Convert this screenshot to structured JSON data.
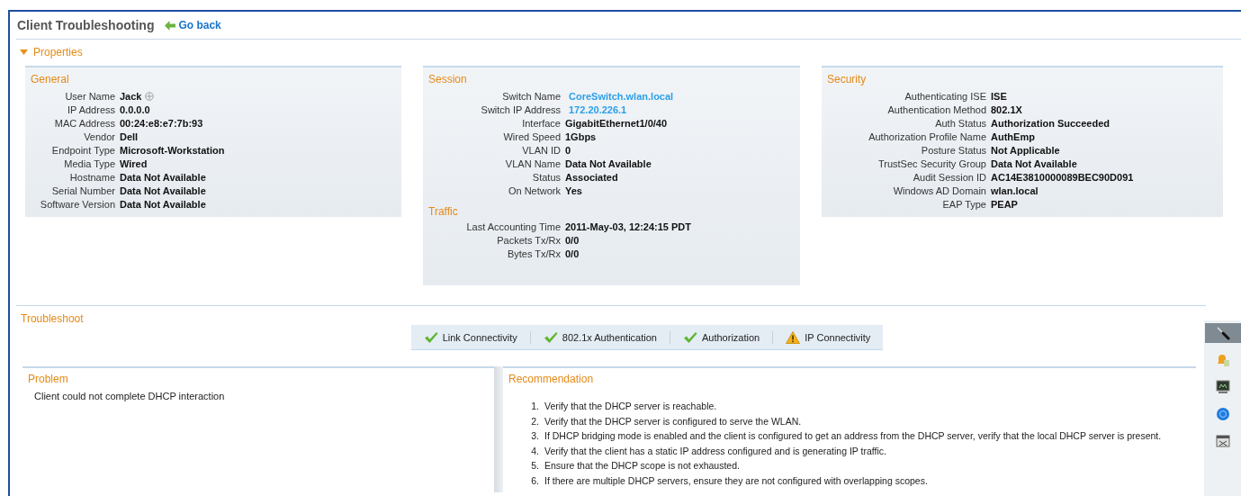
{
  "header": {
    "title": "Client Troubleshooting",
    "back_link": "Go back"
  },
  "properties": {
    "label": "Properties",
    "expanded": true,
    "panels": [
      {
        "title": "General",
        "sections": [
          {
            "fields": [
              {
                "label": "User Name",
                "value": "Jack",
                "kind": "text-with-icon"
              },
              {
                "label": "IP Address",
                "value": "0.0.0.0",
                "kind": "text"
              },
              {
                "label": "MAC Address",
                "value": "00:24:e8:e7:7b:93",
                "kind": "text"
              },
              {
                "label": "Vendor",
                "value": "Dell",
                "kind": "text"
              },
              {
                "label": "Endpoint Type",
                "value": "Microsoft-Workstation",
                "kind": "text"
              },
              {
                "label": "Media Type",
                "value": "Wired",
                "kind": "text"
              },
              {
                "label": "Hostname",
                "value": "Data Not Available",
                "kind": "text"
              },
              {
                "label": "Serial Number",
                "value": "Data Not Available",
                "kind": "text"
              },
              {
                "label": "Software Version",
                "value": "Data Not Available",
                "kind": "text"
              }
            ]
          }
        ]
      },
      {
        "title": "Session",
        "sections": [
          {
            "fields": [
              {
                "label": "Switch Name",
                "value": "CoreSwitch.wlan.local",
                "kind": "link"
              },
              {
                "label": "Switch IP Address",
                "value": "172.20.226.1",
                "kind": "link"
              },
              {
                "label": "Interface",
                "value": "GigabitEthernet1/0/40",
                "kind": "text"
              },
              {
                "label": "Wired Speed",
                "value": "1Gbps",
                "kind": "text"
              },
              {
                "label": "VLAN ID",
                "value": "0",
                "kind": "text"
              },
              {
                "label": "VLAN Name",
                "value": "Data Not Available",
                "kind": "text"
              },
              {
                "label": "Status",
                "value": "Associated",
                "kind": "text"
              },
              {
                "label": "On Network",
                "value": "Yes",
                "kind": "text"
              }
            ]
          },
          {
            "title": "Traffic",
            "fields": [
              {
                "label": "Last Accounting Time",
                "value": "2011-May-03, 12:24:15 PDT",
                "kind": "text"
              },
              {
                "label": "Packets Tx/Rx",
                "value": "0/0",
                "kind": "text"
              },
              {
                "label": "Bytes Tx/Rx",
                "value": "0/0",
                "kind": "text"
              }
            ]
          }
        ]
      },
      {
        "title": "Security",
        "sections": [
          {
            "fields": [
              {
                "label": "Authenticating ISE",
                "value": "ISE",
                "kind": "text"
              },
              {
                "label": "Authentication Method",
                "value": "802.1X",
                "kind": "text"
              },
              {
                "label": "Auth Status",
                "value": "Authorization Succeeded",
                "kind": "text"
              },
              {
                "label": "Authorization Profile Name",
                "value": "AuthEmp",
                "kind": "text"
              },
              {
                "label": "Posture Status",
                "value": "Not Applicable",
                "kind": "text"
              },
              {
                "label": "TrustSec Security Group",
                "value": "Data Not Available",
                "kind": "text"
              },
              {
                "label": "Audit Session ID",
                "value": "AC14E3810000089BEC90D091",
                "kind": "text"
              },
              {
                "label": "Windows AD Domain",
                "value": "wlan.local",
                "kind": "text"
              },
              {
                "label": "EAP Type",
                "value": "PEAP",
                "kind": "text"
              }
            ]
          }
        ]
      }
    ]
  },
  "troubleshoot": {
    "title": "Troubleshoot",
    "steps": [
      {
        "label": "Link Connectivity",
        "kind": "passed"
      },
      {
        "label": "802.1x Authentication",
        "kind": "passed"
      },
      {
        "label": "Authorization",
        "kind": "passed"
      },
      {
        "label": "IP Connectivity",
        "kind": "warning"
      }
    ],
    "problem": {
      "title": "Problem",
      "text": "Client could not complete DHCP interaction"
    },
    "recommendation": {
      "title": "Recommendation",
      "items": [
        {
          "number": "1.",
          "text": "Verify that the DHCP server is reachable."
        },
        {
          "number": "2.",
          "text": "Verify that the DHCP server is configured to serve the WLAN."
        },
        {
          "number": "3.",
          "text": "If DHCP bridging mode is enabled and the client is configured to get an address from the DHCP server, verify that the local DHCP server is present."
        },
        {
          "number": "4.",
          "text": "Verify that the client has a static IP address configured and is generating IP traffic."
        },
        {
          "number": "5.",
          "text": "Ensure that the DHCP scope is not exhausted."
        },
        {
          "number": "6.",
          "text": "If there are multiple DHCP servers, ensure they are not configured with overlapping scopes."
        }
      ]
    }
  },
  "tool_strip": [
    {
      "kind": "wrench",
      "selected": true
    },
    {
      "kind": "bell",
      "selected": false
    },
    {
      "kind": "monitor",
      "selected": false
    },
    {
      "kind": "globe",
      "selected": false
    },
    {
      "kind": "card",
      "selected": false
    }
  ]
}
